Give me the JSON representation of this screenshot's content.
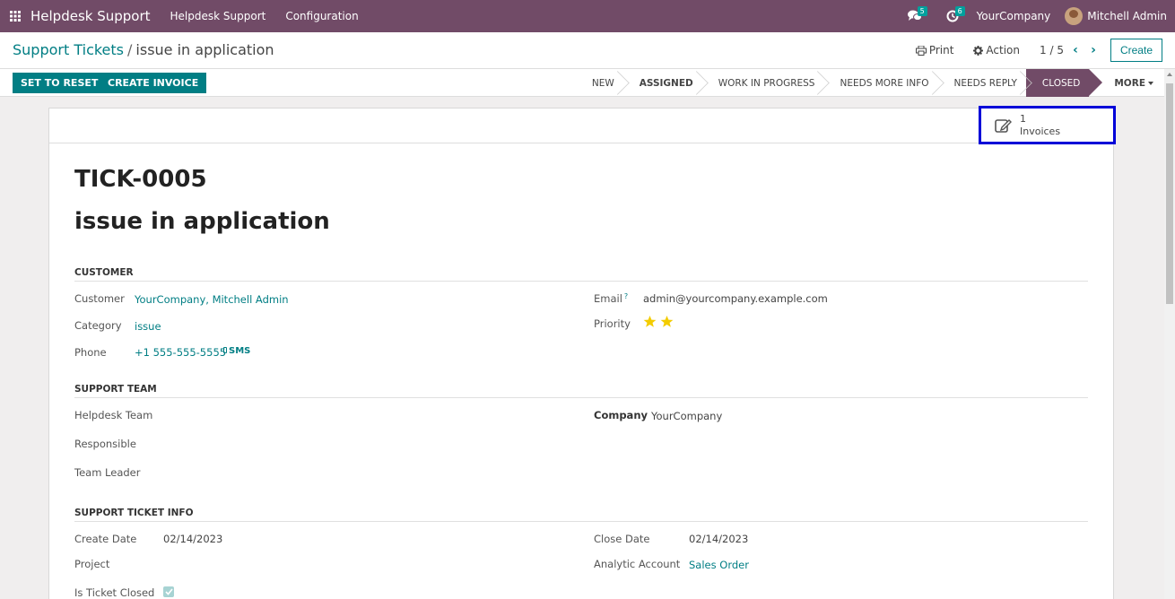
{
  "navbar": {
    "apps_icon": "grid-icon",
    "brand": "Helpdesk Support",
    "menus": [
      "Helpdesk Support",
      "Configuration"
    ],
    "messages_badge": "5",
    "activities_badge": "6",
    "company": "YourCompany",
    "user": "Mitchell Admin",
    "accent_color": "#714b67"
  },
  "control_panel": {
    "breadcrumb_parent": "Support Tickets",
    "breadcrumb_separator": "/",
    "breadcrumb_current": "issue in application",
    "print_label": "Print",
    "action_label": "Action",
    "pager": "1 / 5",
    "create_label": "Create"
  },
  "statusbar": {
    "buttons": [
      "SET TO RESET",
      "CREATE INVOICE"
    ],
    "stages": [
      "NEW",
      "ASSIGNED",
      "WORK IN PROGRESS",
      "NEEDS MORE INFO",
      "NEEDS REPLY",
      "CLOSED"
    ],
    "active_stage": "CLOSED",
    "more_label": "MORE"
  },
  "smart_button": {
    "value": "1",
    "label": "Invoices",
    "icon": "edit-icon"
  },
  "ticket": {
    "reference": "TICK-0005",
    "name": "issue in application"
  },
  "customer_group": {
    "title": "CUSTOMER",
    "customer_label": "Customer",
    "customer_value": "YourCompany, Mitchell Admin",
    "category_label": "Category",
    "category_value": "issue",
    "phone_label": "Phone",
    "phone_value": "+1 555-555-5555",
    "sms_label": "SMS",
    "email_label": "Email",
    "email_help": "?",
    "email_value": "admin@yourcompany.example.com",
    "priority_label": "Priority",
    "priority_stars": 2,
    "star_color": "#f3cc00"
  },
  "support_team_group": {
    "title": "SUPPORT TEAM",
    "helpdesk_team_label": "Helpdesk Team",
    "responsible_label": "Responsible",
    "team_leader_label": "Team Leader",
    "company_label": "Company",
    "company_value": "YourCompany"
  },
  "ticket_info_group": {
    "title": "SUPPORT TICKET INFO",
    "create_date_label": "Create Date",
    "create_date_value": "02/14/2023",
    "project_label": "Project",
    "is_closed_label": "Is Ticket Closed",
    "is_closed_value": true,
    "close_date_label": "Close Date",
    "close_date_value": "02/14/2023",
    "analytic_account_label": "Analytic Account",
    "analytic_account_value": "Sales Order"
  }
}
